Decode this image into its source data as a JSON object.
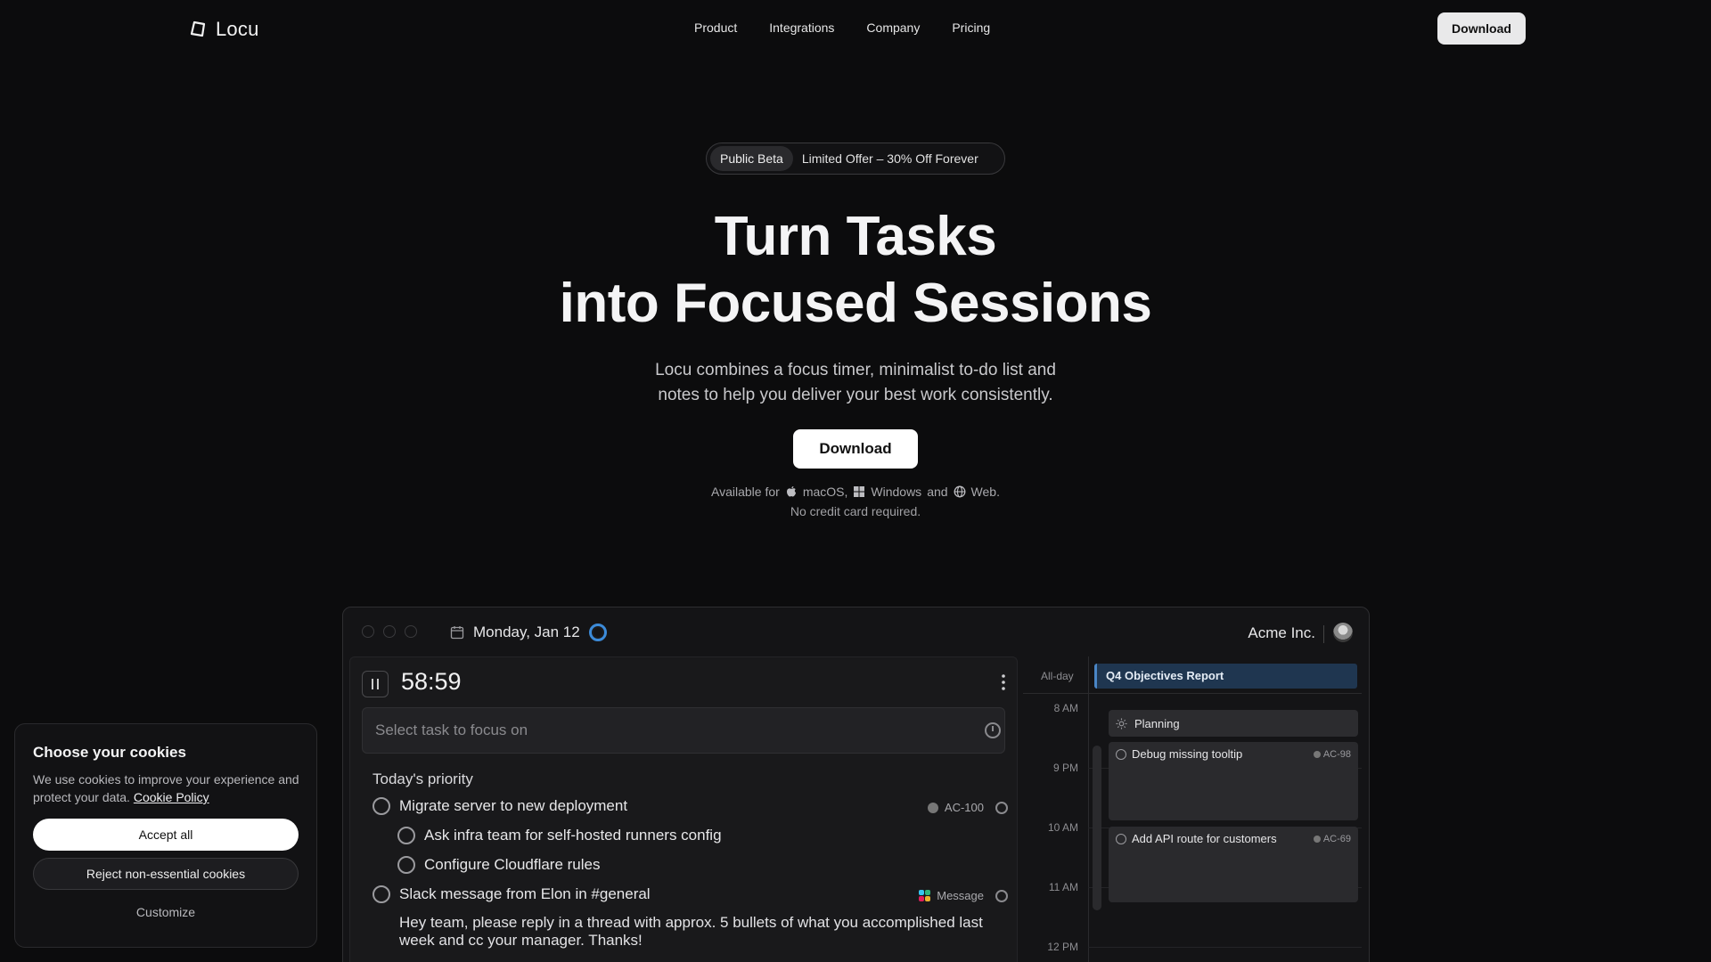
{
  "nav": {
    "logo_text": "Locu",
    "menu": [
      "Product",
      "Integrations",
      "Company",
      "Pricing"
    ],
    "download_label": "Download"
  },
  "hero": {
    "beta_tag": "Public Beta",
    "beta_offer": "Limited Offer – 30% Off Forever",
    "title_line1": "Turn Tasks",
    "title_line2": "into Focused Sessions",
    "subtitle_line1": "Locu combines a focus timer, minimalist to-do list and",
    "subtitle_line2": "notes to help you deliver your best work consistently.",
    "download_label": "Download",
    "available_prefix": "Available for",
    "platform_mac": "macOS,",
    "platform_windows": "Windows",
    "and_text": "and",
    "platform_web": "Web.",
    "no_credit": "No credit card required."
  },
  "app": {
    "date": "Monday, Jan 12",
    "org": "Acme Inc.",
    "timer": "58:59",
    "focus_placeholder": "Select task to focus on",
    "section_title": "Today's priority",
    "tasks": [
      {
        "label": "Migrate server to new deployment",
        "tag": "AC-100"
      },
      {
        "label": "Ask infra team for self-hosted runners config"
      },
      {
        "label": "Configure Cloudflare rules"
      },
      {
        "label": "Slack message from Elon in #general",
        "tag": "Message"
      }
    ],
    "message_body": "Hey team, please reply in a thread with approx. 5 bullets of what you accomplished last week and cc your manager. Thanks!",
    "calendar": {
      "allday_label": "All-day",
      "allday_event": "Q4 Objectives Report",
      "hours": [
        "8 AM",
        "9 PM",
        "10 AM",
        "11 AM",
        "12 PM"
      ],
      "events": [
        {
          "title": "Planning"
        },
        {
          "title": "Debug missing tooltip",
          "tag": "AC-98"
        },
        {
          "title": "Add API route for customers",
          "tag": "AC-69"
        }
      ]
    }
  },
  "cookie": {
    "title": "Choose your cookies",
    "body": "We use cookies to improve your experience and protect your data.",
    "policy_link": "Cookie Policy",
    "accept": "Accept all",
    "reject": "Reject non-essential cookies",
    "customize": "Customize"
  },
  "colors": {
    "background": "#0c0c0d",
    "accent_blue": "#3c8bd9",
    "event_blue": "#1f3650"
  }
}
